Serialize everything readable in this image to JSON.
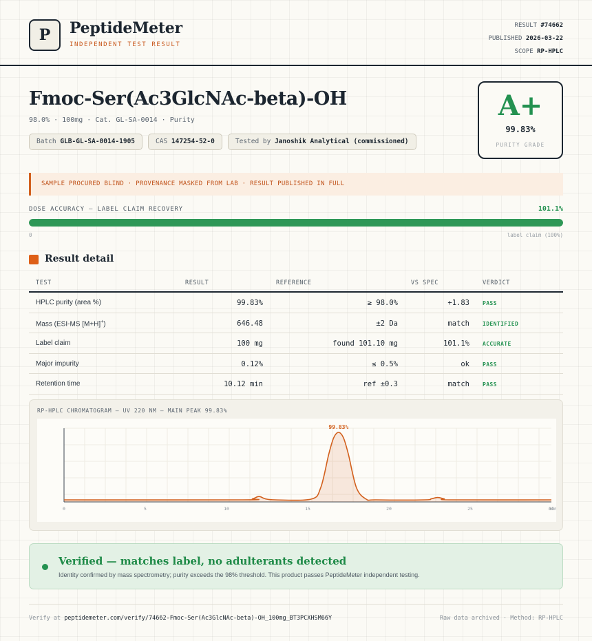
{
  "header": {
    "logo_letter": "P",
    "brand": "PeptideMeter",
    "brand_sub": "INDEPENDENT TEST RESULT",
    "meta": {
      "result_label": "RESULT",
      "result_value": "#74662",
      "published_label": "PUBLISHED",
      "published_value": "2026-03-22",
      "scope_label": "SCOPE",
      "scope_value": "RP-HPLC"
    }
  },
  "product": {
    "title": "Fmoc-Ser(Ac3GlcNAc-beta)-OH",
    "subline": "98.0% · 100mg · Cat. GL-SA-0014 · Purity",
    "pills": {
      "batch_label": "Batch",
      "batch_value": "GLB-GL-SA-0014-1905",
      "cas_label": "CAS",
      "cas_value": "147254-52-0",
      "tested_label": "Tested by",
      "tested_value": "Janoshik Analytical (commissioned)"
    }
  },
  "grade": {
    "letter": "A+",
    "value": "99.83%",
    "label": "PURITY GRADE",
    "color": "#239150"
  },
  "notice": "SAMPLE PROCURED BLIND · PROVENANCE MASKED FROM LAB · RESULT PUBLISHED IN FULL",
  "dose": {
    "label": "DOSE ACCURACY — LABEL CLAIM RECOVERY",
    "value": "101.1%",
    "fill_percent": 100,
    "zero_label": "0",
    "claim_label": "label claim (100%)"
  },
  "section": {
    "title": "Result detail"
  },
  "table": {
    "headers": {
      "test": "TEST",
      "result": "RESULT",
      "reference": "REFERENCE",
      "vs": "VS SPEC",
      "verdict": "VERDICT"
    },
    "rows": [
      {
        "test": "HPLC purity (area %)",
        "result": "99.83%",
        "reference": "≥ 98.0%",
        "vs": "+1.83",
        "verdict": "PASS"
      },
      {
        "test": "Mass (ESI-MS [M+H]",
        "test_sup": "+",
        "test_end": ")",
        "result": "646.48",
        "reference": "±2 Da",
        "vs": "match",
        "verdict": "IDENTIFIED"
      },
      {
        "test": "Label claim",
        "result": "100 mg",
        "reference": "found 101.10 mg",
        "vs": "101.1%",
        "verdict": "ACCURATE"
      },
      {
        "test": "Major impurity",
        "result": "0.12%",
        "reference": "≤ 0.5%",
        "vs": "ok",
        "verdict": "PASS"
      },
      {
        "test": "Retention time",
        "result": "10.12 min",
        "reference": "ref ±0.3",
        "vs": "match",
        "verdict": "PASS"
      }
    ]
  },
  "chart_data": {
    "type": "line",
    "title": "RP-HPLC CHROMATOGRAM — UV 220 NM — MAIN PEAK 99.83%",
    "xlabel": "",
    "ylabel": "",
    "xlim": [
      0,
      30
    ],
    "ylim": [
      0,
      100
    ],
    "x_ticks": [
      "0",
      "5",
      "10",
      "15",
      "20",
      "25",
      "30",
      "min"
    ],
    "peak_label": "99.83%",
    "color": "#d2601d",
    "series": [
      {
        "x": [
          0,
          11,
          11.6,
          12,
          12.4,
          13,
          15.2,
          15.8,
          16.3,
          16.6,
          16.9,
          17.2,
          17.5,
          18,
          18.6,
          19.2,
          22.2,
          22.6,
          23,
          23.4,
          23.8,
          30
        ],
        "y": [
          0,
          0,
          1.5,
          5,
          1.5,
          0,
          1,
          18,
          68,
          92,
          100,
          92,
          68,
          18,
          1,
          0,
          0,
          1.5,
          3.5,
          1.5,
          0,
          0
        ]
      }
    ]
  },
  "verified": {
    "title": "Verified — matches label, no adulterants detected",
    "text": "Identity confirmed by mass spectrometry; purity exceeds the 98% threshold. This product passes PeptideMeter independent testing."
  },
  "footer": {
    "verify_prefix": "Verify at",
    "verify_url": "peptidemeter.com/verify/74662-Fmoc-Ser(Ac3GlcNAc-beta)-OH_100mg_BT3PCXHSM66Y",
    "right": "Raw data archived · Method: RP-HPLC"
  }
}
